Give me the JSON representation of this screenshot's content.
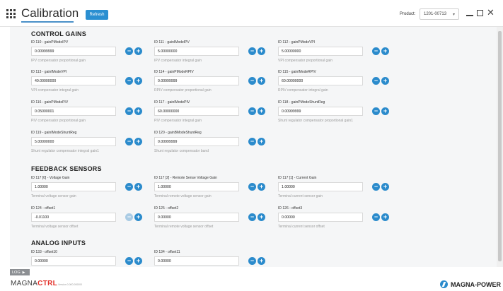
{
  "header": {
    "title": "Calibration",
    "refresh_label": "Refresh",
    "product_label": "Product:",
    "product_value": "1201-00713"
  },
  "sections": {
    "control_gains": "CONTROL GAINS",
    "feedback_sensors": "FEEDBACK SENSORS",
    "analog_inputs": "ANALOG INPUTS"
  },
  "params": [
    {
      "label": "ID 110 - gainPModeIPV",
      "value": "0.00999999",
      "desc": "IPV compensator proportional gain"
    },
    {
      "label": "ID 111 - gainIModeIPV",
      "value": "5.00000000",
      "desc": "IPV compensator integral gain"
    },
    {
      "label": "ID 112 - gainPModeVPI",
      "value": "5.00000000",
      "desc": "VPI compensator proportional gain"
    },
    {
      "label": "ID 113 - gainIModeVPI",
      "value": "40.00000000",
      "desc": "VPI compensator integral gain"
    },
    {
      "label": "ID 114 - gainPModeRPIV",
      "value": "0.00999999",
      "desc": "RPIV compensator proportional gain"
    },
    {
      "label": "ID 115 - gainIModeRPIV",
      "value": "60.00000000",
      "desc": "RPIV compensator integral gain"
    },
    {
      "label": "ID 116 - gainPModePIV",
      "value": "0.05000001",
      "desc": "PIV compensator proportional gain"
    },
    {
      "label": "ID 117 - gainIModePIV",
      "value": "60.00000000",
      "desc": "PIV compensator integral gain"
    },
    {
      "label": "ID 118 - gainPModeShuntReg",
      "value": "0.00999999",
      "desc": "Shunt regulator compensator proportional gain1"
    },
    {
      "label": "ID 119 - gainIModeShuntReg",
      "value": "5.00000000",
      "desc": "Shunt regulator compensator integral gain1"
    },
    {
      "label": "ID 120 - gainBModeShuntReg",
      "value": "0.00999999",
      "desc": "Shunt regulator compensator band"
    },
    {
      "label": "ID 117 [0] - Voltage Gain",
      "value": "1.00000",
      "desc": "Terminal voltage sensor gain"
    },
    {
      "label": "ID 117 [2] - Remote Sense Voltage Gain",
      "value": "1.00000",
      "desc": "Terminal remote voltage sensor gain"
    },
    {
      "label": "ID 117 [1] - Current Gain",
      "value": "1.00000",
      "desc": "Terminal current sensor gain"
    },
    {
      "label": "ID 124 - offset1",
      "value": "-0.01100",
      "desc": "Terminal voltage sensor offset"
    },
    {
      "label": "ID 125 - offset2",
      "value": "0.00000",
      "desc": "Terminal remote voltage sensor offset"
    },
    {
      "label": "ID 126 - offset3",
      "value": "0.00000",
      "desc": "Terminal current sensor offset"
    },
    {
      "label": "ID 133 - offset10",
      "value": "0.00000",
      "desc": ""
    },
    {
      "label": "ID 134 - offset11",
      "value": "0.00000",
      "desc": ""
    }
  ],
  "buttons": {
    "minus": "−",
    "plus": "+"
  },
  "log_tab": "LOG",
  "footer": {
    "brand_magna": "MAGNA",
    "brand_ctrl": "CTRL",
    "version": "Version 0.000.000000",
    "company": "MAGNA-POWER"
  },
  "colors": {
    "accent": "#2b8bcc",
    "brand_red": "#e3322b"
  }
}
